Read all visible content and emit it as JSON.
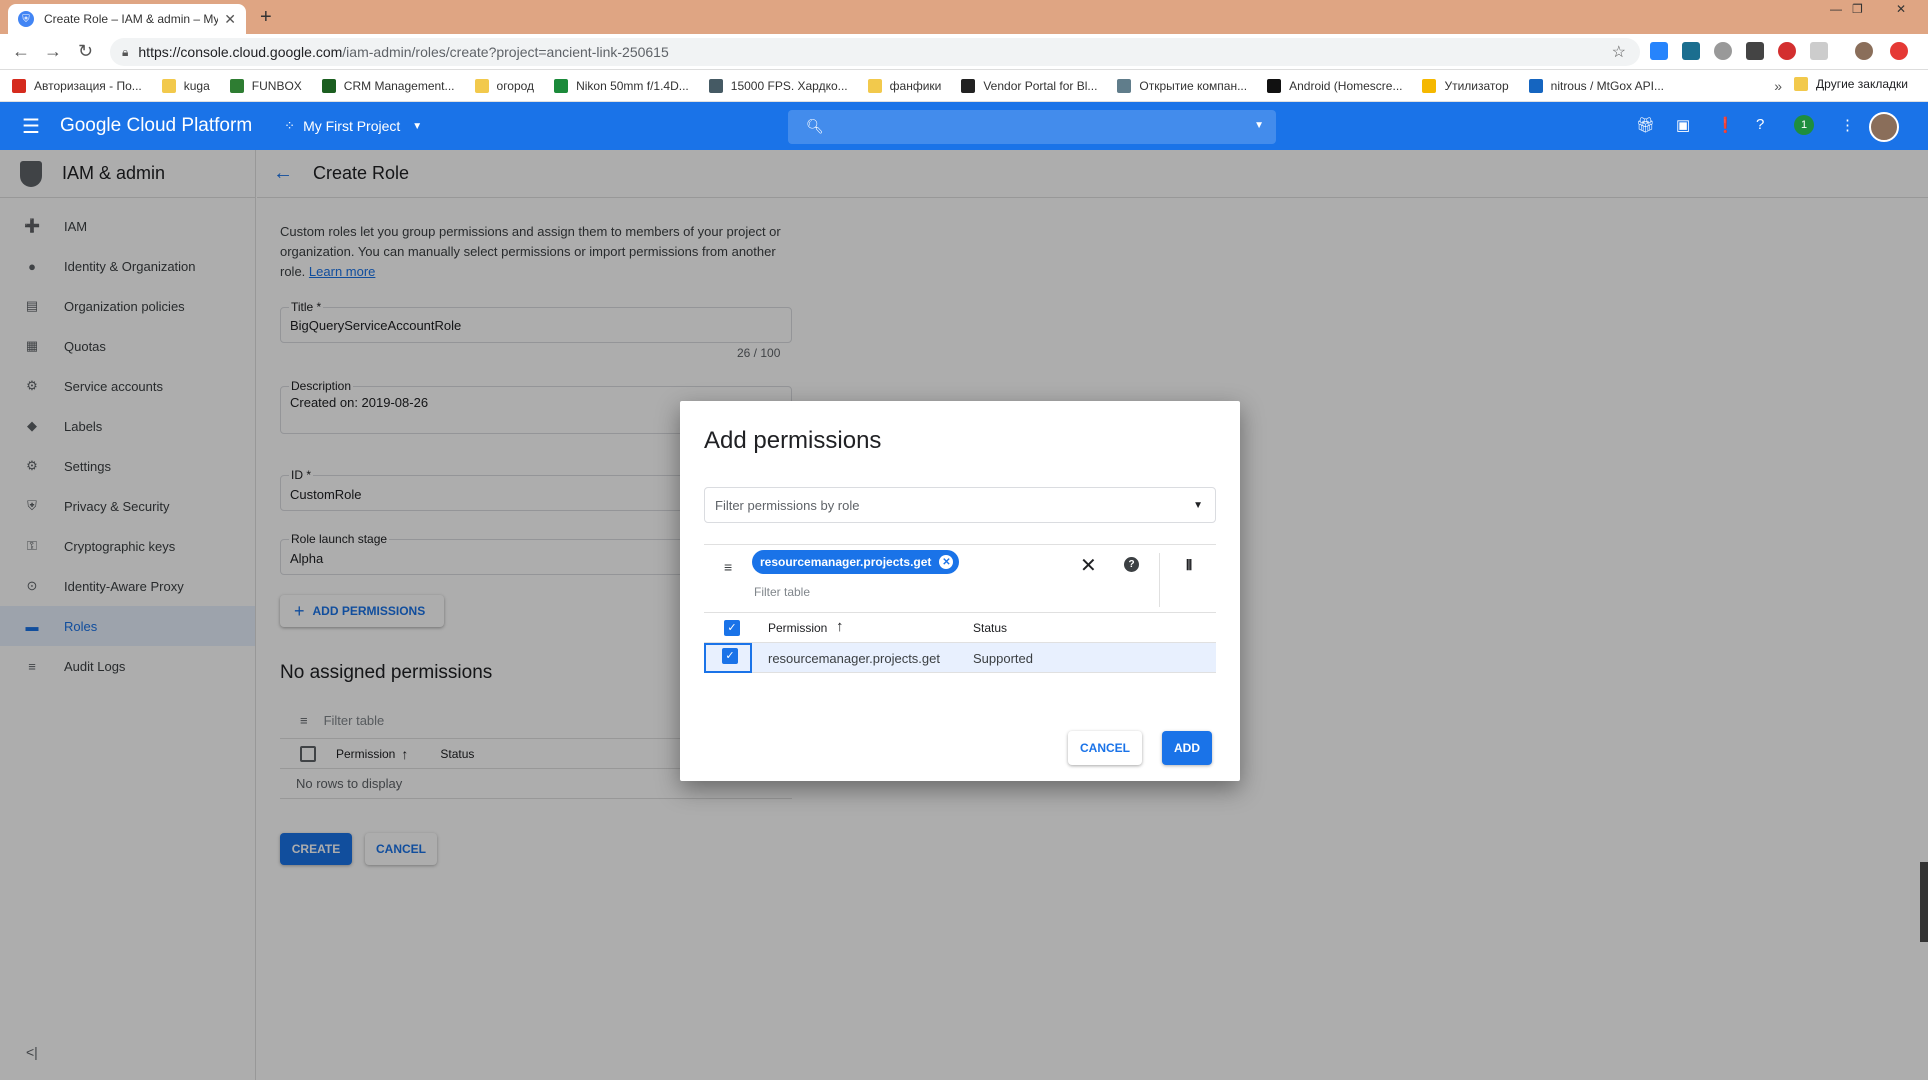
{
  "browser": {
    "tab_title": "Create Role – IAM & admin – My",
    "url_host": "https://console.cloud.google.com",
    "url_path": "/iam-admin/roles/create?project=ancient-link-250615",
    "bookmarks": [
      {
        "label": "Авторизация - По...",
        "color": "#d52b1e"
      },
      {
        "label": "kuga",
        "color": "#f2c94c"
      },
      {
        "label": "FUNBOX",
        "color": "#2e7d32"
      },
      {
        "label": "CRM Management...",
        "color": "#1b5e20"
      },
      {
        "label": "огород",
        "color": "#f2c94c"
      },
      {
        "label": "Nikon 50mm f/1.4D...",
        "color": "#1b8a3a"
      },
      {
        "label": "15000 FPS. Хардко...",
        "color": "#455a64"
      },
      {
        "label": "фанфики",
        "color": "#f2c94c"
      },
      {
        "label": "Vendor Portal for Bl...",
        "color": "#222222"
      },
      {
        "label": "Открытие компан...",
        "color": "#607d8b"
      },
      {
        "label": "Android (Homescre...",
        "color": "#111111"
      },
      {
        "label": "Утилизатор",
        "color": "#f5b800"
      },
      {
        "label": "nitrous / MtGox API...",
        "color": "#1565c0"
      }
    ],
    "other_bookmarks": "Другие закладки"
  },
  "header": {
    "product": "Google Cloud Platform",
    "project": "My First Project",
    "notification_count": "1"
  },
  "sidebar": {
    "section": "IAM & admin",
    "items": [
      {
        "label": "IAM",
        "icon": "person-add"
      },
      {
        "label": "Identity & Organization",
        "icon": "account-circle"
      },
      {
        "label": "Organization policies",
        "icon": "list"
      },
      {
        "label": "Quotas",
        "icon": "quota"
      },
      {
        "label": "Service accounts",
        "icon": "service-account"
      },
      {
        "label": "Labels",
        "icon": "label"
      },
      {
        "label": "Settings",
        "icon": "gear"
      },
      {
        "label": "Privacy & Security",
        "icon": "shield"
      },
      {
        "label": "Cryptographic keys",
        "icon": "key"
      },
      {
        "label": "Identity-Aware Proxy",
        "icon": "proxy"
      },
      {
        "label": "Roles",
        "icon": "roles"
      },
      {
        "label": "Audit Logs",
        "icon": "logs"
      }
    ],
    "active_index": 10
  },
  "main": {
    "page_title": "Create Role",
    "intro": "Custom roles let you group permissions and assign them to members of your project or organization. You can manually select permissions or import permissions from another role.",
    "learn_more": "Learn more",
    "title_label": "Title *",
    "title_value": "BigQueryServiceAccountRole",
    "title_counter": "26 / 100",
    "description_label": "Description",
    "description_value": "Created on: 2019-08-26",
    "id_label": "ID *",
    "id_value": "CustomRole",
    "stage_label": "Role launch stage",
    "stage_value": "Alpha",
    "add_permissions": "ADD PERMISSIONS",
    "no_assigned": "No assigned permissions",
    "filter_table": "Filter table",
    "col_permission": "Permission",
    "col_status": "Status",
    "no_rows": "No rows to display",
    "create": "CREATE",
    "cancel": "CANCEL"
  },
  "dialog": {
    "title": "Add permissions",
    "role_filter_placeholder": "Filter permissions by role",
    "chip": "resourcemanager.projects.get",
    "filter_table": "Filter table",
    "col_permission": "Permission",
    "col_status": "Status",
    "rows": [
      {
        "permission": "resourcemanager.projects.get",
        "status": "Supported",
        "checked": true
      }
    ],
    "cancel": "CANCEL",
    "add": "ADD"
  }
}
